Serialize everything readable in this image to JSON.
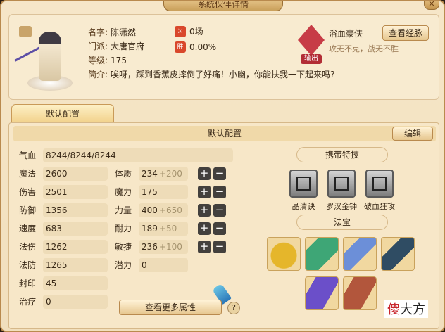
{
  "window": {
    "title": "系统伙伴详情",
    "close_glyph": "×"
  },
  "partner": {
    "name_label": "名字:",
    "name": "陈潇然",
    "school_label": "门派:",
    "school": "大唐官府",
    "level_label": "等级:",
    "level": "175",
    "intro_label": "简介:",
    "intro": "唉呀，踩到香蕉皮摔倒了好痛！小幽，你能扶我一下起来吗?",
    "battles": "0场",
    "win_badge": "胜",
    "win_rate": "0.00%"
  },
  "special_skill": {
    "name": "浴血豪侠",
    "role_badge": "输出",
    "view_button": "查看经脉",
    "description": "攻无不克，战无不胜"
  },
  "tab": {
    "label": "默认配置"
  },
  "config": {
    "header": "默认配置",
    "edit_button": "编辑",
    "hp": {
      "label": "气血",
      "value": "8244/8244/8244"
    },
    "left_stats": [
      {
        "label": "魔法",
        "value": "2600"
      },
      {
        "label": "伤害",
        "value": "2501"
      },
      {
        "label": "防御",
        "value": "1356"
      },
      {
        "label": "速度",
        "value": "683"
      },
      {
        "label": "法伤",
        "value": "1262"
      },
      {
        "label": "法防",
        "value": "1265"
      },
      {
        "label": "封印",
        "value": "45"
      },
      {
        "label": "治疗",
        "value": "0"
      }
    ],
    "right_stats": [
      {
        "label": "体质",
        "value": "234",
        "bonus": "+200"
      },
      {
        "label": "魔力",
        "value": "175",
        "bonus": ""
      },
      {
        "label": "力量",
        "value": "400",
        "bonus": "+650"
      },
      {
        "label": "耐力",
        "value": "189",
        "bonus": "+50"
      },
      {
        "label": "敏捷",
        "value": "236",
        "bonus": "+100"
      },
      {
        "label": "潜力",
        "value": "0",
        "bonus": ""
      }
    ],
    "plus_glyph": "+",
    "minus_glyph": "−",
    "more_button": "查看更多属性",
    "help_glyph": "?"
  },
  "carried_skills": {
    "title": "携带特技",
    "items": [
      {
        "label": "晶清诀",
        "icon": "crystal-skill-icon"
      },
      {
        "label": "罗汉金钟",
        "icon": "golden-bell-skill-icon"
      },
      {
        "label": "破血狂攻",
        "icon": "frenzy-skill-icon"
      }
    ]
  },
  "treasures": {
    "title": "法宝"
  },
  "watermark": {
    "prefix": "傻",
    "suffix": "大方"
  }
}
